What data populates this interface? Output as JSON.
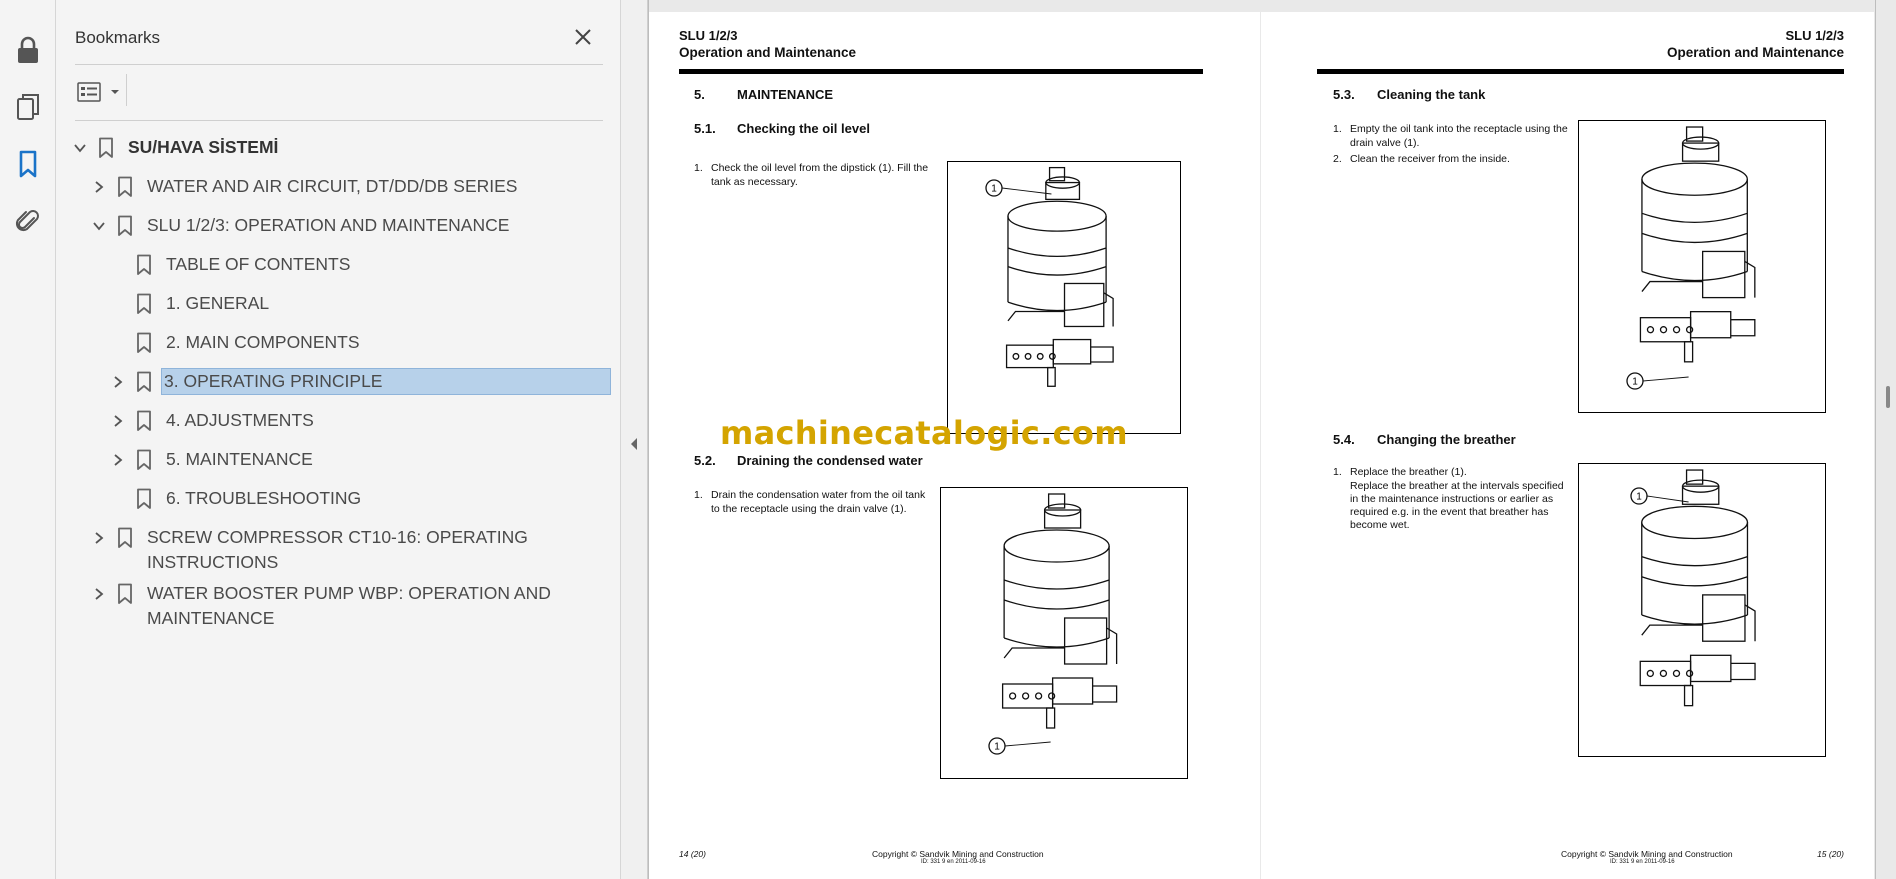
{
  "sidebar_icons": [
    "lock-icon",
    "pages-icon",
    "bookmark-icon",
    "attachment-icon"
  ],
  "panel": {
    "title": "Bookmarks",
    "close_glyph": "✕",
    "options_icon": "options-list-icon"
  },
  "bookmarks": [
    {
      "label": "SU/HAVA SİSTEMİ",
      "chevron": "down",
      "level": 0,
      "bold": true
    },
    {
      "label": "WATER AND AIR CIRCUIT, DT/DD/DB SERIES",
      "chevron": "right",
      "level": 1
    },
    {
      "label": "SLU 1/2/3: OPERATION AND MAINTENANCE",
      "chevron": "down",
      "level": 1
    },
    {
      "label": "TABLE OF CONTENTS",
      "chevron": "none",
      "level": 2
    },
    {
      "label": "1. GENERAL",
      "chevron": "none",
      "level": 2
    },
    {
      "label": "2. MAIN COMPONENTS",
      "chevron": "none",
      "level": 2
    },
    {
      "label": "3. OPERATING PRINCIPLE",
      "chevron": "right",
      "level": 2,
      "selected": true
    },
    {
      "label": "4. ADJUSTMENTS",
      "chevron": "right",
      "level": 2
    },
    {
      "label": "5. MAINTENANCE",
      "chevron": "right",
      "level": 2
    },
    {
      "label": "6. TROUBLESHOOTING",
      "chevron": "none",
      "level": 2
    },
    {
      "label": "SCREW COMPRESSOR CT10-16: OPERATING",
      "label2": "INSTRUCTIONS",
      "chevron": "right",
      "level": 1
    },
    {
      "label": "WATER BOOSTER PUMP WBP: OPERATION AND",
      "label2": "MAINTENANCE",
      "chevron": "right",
      "level": 1
    }
  ],
  "pages": {
    "left": {
      "header_line1": "SLU 1/2/3",
      "header_line2": "Operation and Maintenance",
      "section_num": "5.",
      "section_title": "MAINTENANCE",
      "s51_num": "5.1.",
      "s51_title": "Checking the oil level",
      "s51_step_num": "1.",
      "s51_step_line1": "Check the oil level from the dipstick (1). Fill the",
      "s51_step_line2": "tank as necessary.",
      "s52_num": "5.2.",
      "s52_title": "Draining the condensed water",
      "s52_step_num": "1.",
      "s52_step_line1": "Drain the condensation water from the oil tank",
      "s52_step_line2": "to the receptacle using the drain valve (1).",
      "callout": "1",
      "footer_page": "14 (20)",
      "footer_copyright": "Copyright © Sandvik Mining and Construction",
      "footer_id": "ID: 331 9 en 2011-09-16"
    },
    "right": {
      "header_line1": "SLU 1/2/3",
      "header_line2": "Operation and Maintenance",
      "s53_num": "5.3.",
      "s53_title": "Cleaning the tank",
      "s53_step1_num": "1.",
      "s53_step1_line1": "Empty the oil tank into the receptacle using the",
      "s53_step1_line2": "drain valve (1).",
      "s53_step2_num": "2.",
      "s53_step2_line1": "Clean the receiver from the inside.",
      "s54_num": "5.4.",
      "s54_title": "Changing the breather",
      "s54_step_num": "1.",
      "s54_line1": "Replace the breather (1).",
      "s54_line2": "Replace the breather at the intervals specified",
      "s54_line3": "in the maintenance instructions or earlier as",
      "s54_line4": "required e.g. in the event that breather has",
      "s54_line5": "become wet.",
      "callout": "1",
      "footer_page": "15 (20)",
      "footer_copyright": "Copyright © Sandvik Mining and Construction",
      "footer_id": "ID: 331 9 en 2011-09-16"
    }
  },
  "watermark": "machinecatalogic.com",
  "colors": {
    "selected_bg": "#b7d1ea",
    "active_icon": "#1a73c8",
    "watermark": "#d4a400"
  }
}
